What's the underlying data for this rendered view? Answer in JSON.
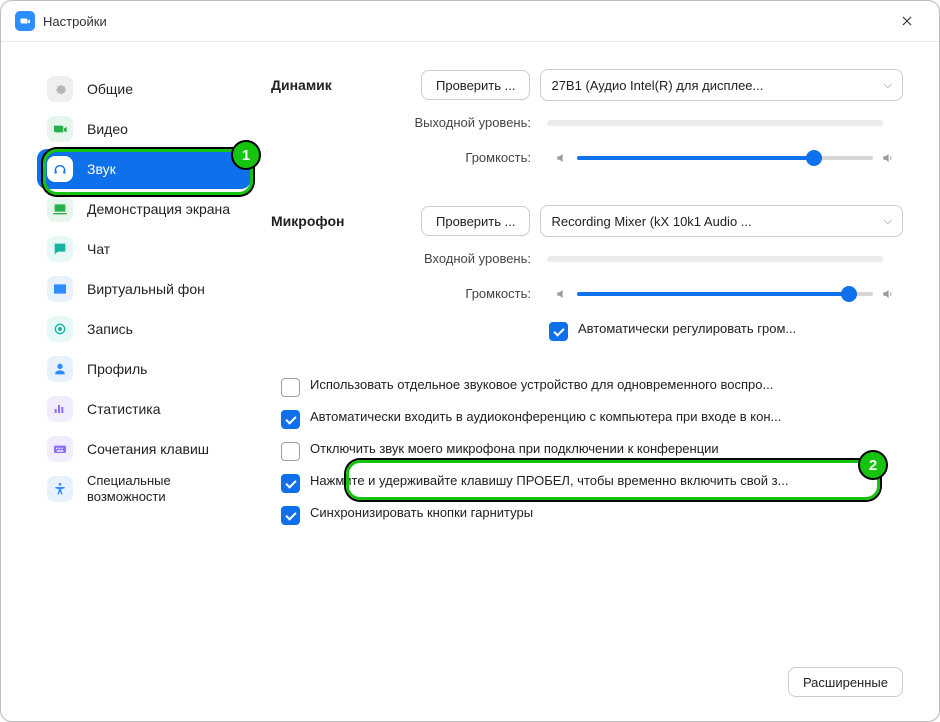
{
  "window": {
    "title": "Настройки"
  },
  "sidebar": {
    "items": [
      {
        "id": "general",
        "label": "Общие"
      },
      {
        "id": "video",
        "label": "Видео"
      },
      {
        "id": "audio",
        "label": "Звук"
      },
      {
        "id": "share",
        "label": "Демонстрация экрана"
      },
      {
        "id": "chat",
        "label": "Чат"
      },
      {
        "id": "vbg",
        "label": "Виртуальный фон"
      },
      {
        "id": "record",
        "label": "Запись"
      },
      {
        "id": "profile",
        "label": "Профиль"
      },
      {
        "id": "stats",
        "label": "Статистика"
      },
      {
        "id": "keys",
        "label": "Сочетания клавиш"
      },
      {
        "id": "access",
        "label": "Специальные возможности"
      }
    ],
    "selected_id": "audio"
  },
  "callouts": {
    "one": "1",
    "two": "2"
  },
  "speaker": {
    "section_label": "Динамик",
    "test_label": "Проверить ...",
    "device": "27B1 (Аудио Intel(R) для дисплее...",
    "output_level_label": "Выходной уровень:",
    "volume_label": "Громкость:",
    "volume_percent": 80
  },
  "mic": {
    "section_label": "Микрофон",
    "test_label": "Проверить ...",
    "device": "Recording Mixer (kX 10k1 Audio ...",
    "input_level_label": "Входной уровень:",
    "volume_label": "Громкость:",
    "volume_percent": 92,
    "auto_adjust_label": "Автоматически регулировать гром..."
  },
  "options": {
    "separate_device": "Использовать отдельное звуковое устройство для одновременного воспро...",
    "auto_join": "Автоматически входить в аудиоконференцию с компьютера при входе в кон...",
    "mute_mic": "Отключить звук моего микрофона при подключении к конференции",
    "space_unmute": "Нажмите и удерживайте клавишу ПРОБЕЛ, чтобы временно включить свой з...",
    "headset_sync": "Синхронизировать кнопки гарнитуры"
  },
  "advanced_button": "Расширенные"
}
